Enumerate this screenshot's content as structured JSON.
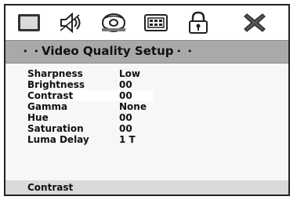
{
  "icons": [
    {
      "name": "tv-icon"
    },
    {
      "name": "speaker-icon"
    },
    {
      "name": "disc-icon"
    },
    {
      "name": "keypad-icon"
    },
    {
      "name": "lock-icon"
    },
    {
      "name": "close-icon"
    }
  ],
  "title": {
    "text": "Video Quality Setup",
    "left_dots": "• •",
    "right_dots": "• •"
  },
  "settings": [
    {
      "label": "Sharpness",
      "value": "Low"
    },
    {
      "label": "Brightness",
      "value": "00"
    },
    {
      "label": "Contrast",
      "value": "00",
      "selected": true
    },
    {
      "label": "Gamma",
      "value": "None"
    },
    {
      "label": "Hue",
      "value": "00"
    },
    {
      "label": "Saturation",
      "value": "00"
    },
    {
      "label": "Luma Delay",
      "value": "1 T"
    }
  ],
  "status": {
    "text": "Contrast"
  },
  "colors": {
    "title_bar": "#a9a9a9",
    "background": "#f7f7f7",
    "selected_row": "#ffffff"
  }
}
